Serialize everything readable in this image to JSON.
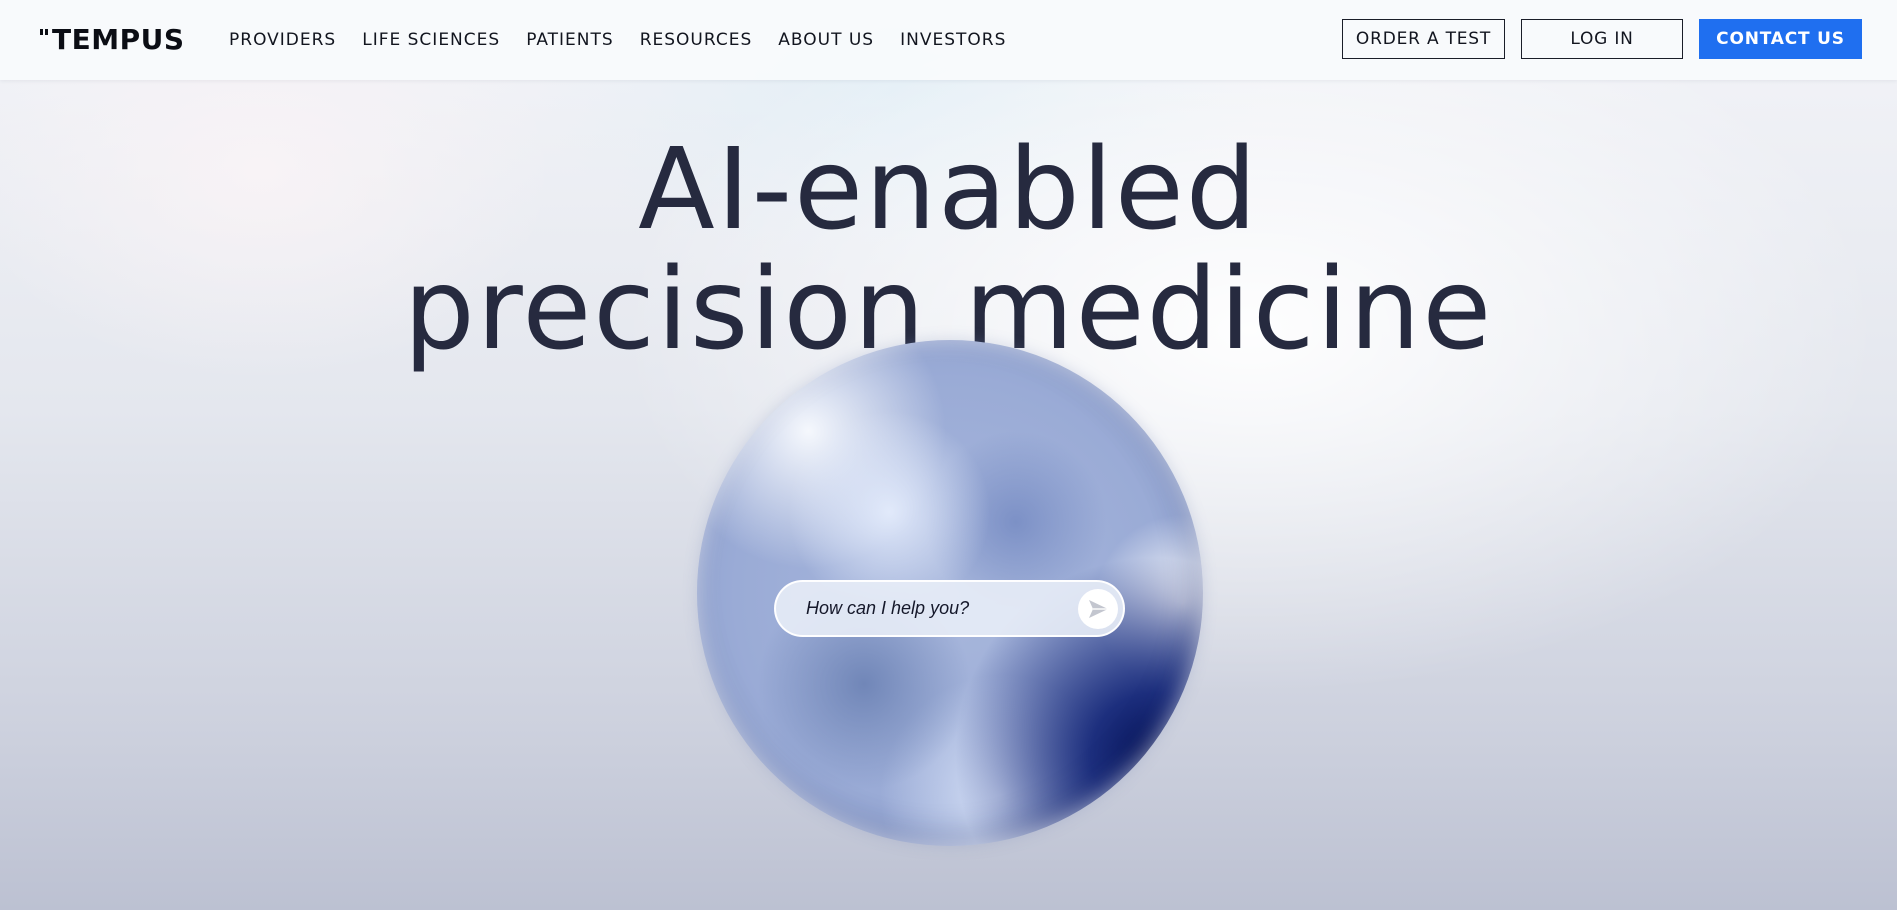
{
  "brand": {
    "logo_text": "TEMPUS"
  },
  "nav": {
    "items": [
      {
        "label": "PROVIDERS"
      },
      {
        "label": "LIFE SCIENCES"
      },
      {
        "label": "PATIENTS"
      },
      {
        "label": "RESOURCES"
      },
      {
        "label": "ABOUT US"
      },
      {
        "label": "INVESTORS"
      }
    ]
  },
  "header_buttons": {
    "order_test": "ORDER A TEST",
    "log_in": "LOG IN",
    "contact_us": "CONTACT US"
  },
  "hero": {
    "title_line1": "AI-enabled",
    "title_line2": "precision medicine"
  },
  "chat": {
    "placeholder": "How can I help you?",
    "send_icon": "paper-plane-icon"
  },
  "colors": {
    "accent": "#1f6ff0",
    "heading": "#262a3f",
    "text": "#12151f"
  }
}
